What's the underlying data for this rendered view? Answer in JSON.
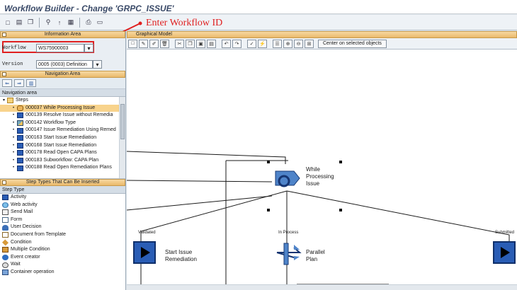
{
  "title": "Workflow Builder - Change 'GRPC_ISSUE'",
  "annotation": "Enter Workflow ID",
  "toolbar_icons": [
    "new-icon",
    "save-icon",
    "copy-icon",
    "test-icon",
    "activate-icon",
    "info-icon",
    "print-icon",
    "help-icon"
  ],
  "info_area": {
    "header": "Information Area",
    "workflow_label": "Workflow",
    "workflow_value": "WS75900003",
    "version_label": "Version",
    "version_value": "0005 (0003) Definition"
  },
  "navigation": {
    "header": "Navigation Area",
    "list_header": "Navigation area",
    "root": "Steps",
    "items": [
      {
        "label": "000037 While Processing Issue",
        "selected": true,
        "icon": "loop-icon"
      },
      {
        "label": "000139 Resolve Issue without Remedia",
        "icon": "step-icon"
      },
      {
        "label": "000142 Workflow Type",
        "icon": "type-icon"
      },
      {
        "label": "000147 Issue Remediation Using Remed",
        "icon": "step-icon"
      },
      {
        "label": "000163 Start Issue Remediation",
        "icon": "step-icon"
      },
      {
        "label": "000168 Start Issue Remediation",
        "icon": "step-icon"
      },
      {
        "label": "000178 Read Open CAPA Plans",
        "icon": "step-icon"
      },
      {
        "label": "000183 Subworkflow: CAPA Plan",
        "icon": "step-icon"
      },
      {
        "label": "000188 Read Open Remediation Plans",
        "icon": "step-icon"
      }
    ]
  },
  "step_types": {
    "header": "Step Types That Can Be Inserted",
    "list_header": "Step Type",
    "items": [
      {
        "label": "Activity",
        "icon": "ti-blue"
      },
      {
        "label": "Web activity",
        "icon": "ti-globe"
      },
      {
        "label": "Send Mail",
        "icon": "ti-mail"
      },
      {
        "label": "Form",
        "icon": "ti-form"
      },
      {
        "label": "User Decision",
        "icon": "ti-user"
      },
      {
        "label": "Document from Template",
        "icon": "ti-doc"
      },
      {
        "label": "Condition",
        "icon": "ti-cond"
      },
      {
        "label": "Multiple Condition",
        "icon": "ti-multi"
      },
      {
        "label": "Event creator",
        "icon": "ti-event"
      },
      {
        "label": "Wait",
        "icon": "ti-wait"
      },
      {
        "label": "Container operation",
        "icon": "ti-cont"
      }
    ]
  },
  "graphical_model": {
    "header": "Graphical Model",
    "center_button": "Center on selected objects",
    "nodes": {
      "while": "While Processing Issue",
      "start": "Start Issue Remediation",
      "parallel": "Parallel Plan"
    },
    "edge_labels": {
      "validated": "Validated",
      "in_process": "In Process",
      "submitted": "Submitted"
    }
  }
}
